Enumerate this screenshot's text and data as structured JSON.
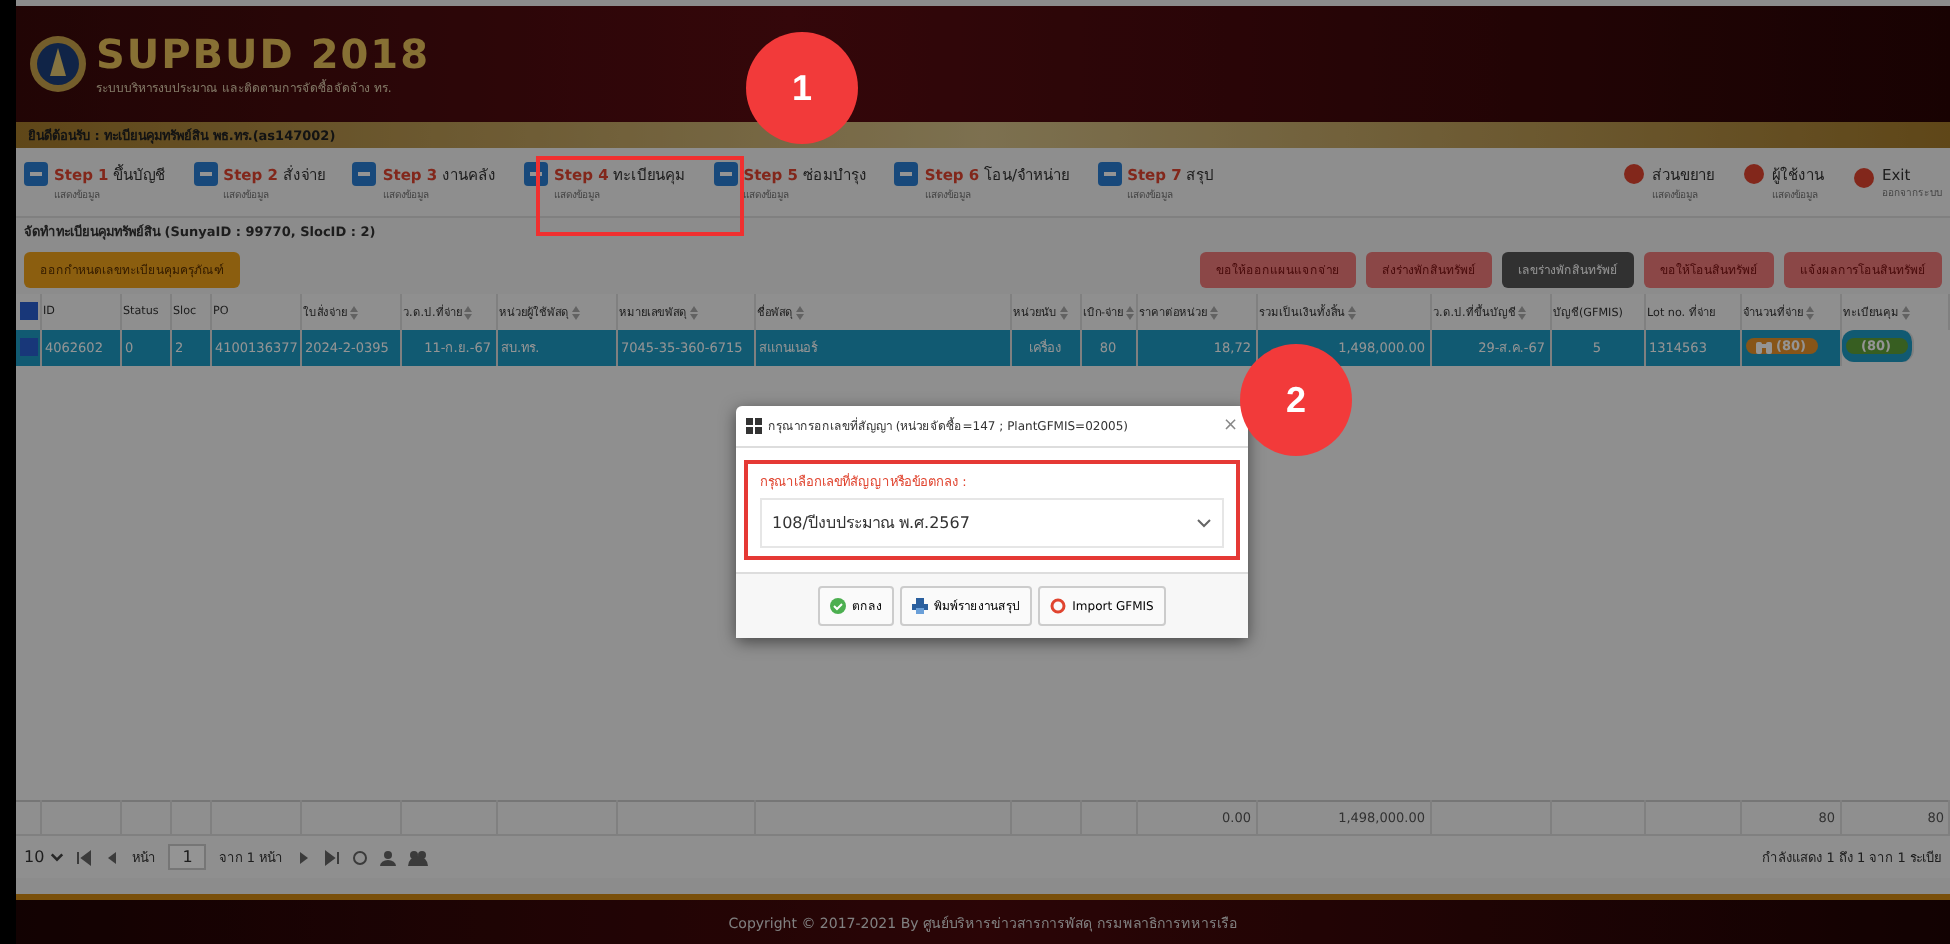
{
  "header": {
    "logo_text": "SUPBUD 2018",
    "subtitle": "ระบบบริหารงบประมาณ และติดตามการจัดซื้อจัดจ้าง ทร."
  },
  "welcome": "ยินดีต้อนรับ : ทะเบียนคุมทรัพย์สิน พธ.ทร.(as147002)",
  "steps": [
    {
      "step": "Step 1",
      "label": "ขึ้นบัญชี",
      "sub": "แสดงข้อมูล"
    },
    {
      "step": "Step 2",
      "label": "สั่งจ่าย",
      "sub": "แสดงข้อมูล"
    },
    {
      "step": "Step 3",
      "label": "งานคลัง",
      "sub": "แสดงข้อมูล"
    },
    {
      "step": "Step 4",
      "label": "ทะเบียนคุม",
      "sub": "แสดงข้อมูล"
    },
    {
      "step": "Step 5",
      "label": "ซ่อมบำรุง",
      "sub": "แสดงข้อมูล"
    },
    {
      "step": "Step 6",
      "label": "โอน/จำหน่าย",
      "sub": "แสดงข้อมูล"
    },
    {
      "step": "Step 7",
      "label": "สรุป",
      "sub": "แสดงข้อมูล"
    }
  ],
  "right_menu": [
    {
      "label": "ส่วนขยาย",
      "sub": "แสดงข้อมูล"
    },
    {
      "label": "ผู้ใช้งาน",
      "sub": "แสดงข้อมูล"
    },
    {
      "label": "Exit",
      "sub": "ออกจากระบบ"
    }
  ],
  "page_title": "จัดทำทะเบียนคุมทรัพย์สิน (SunyaID : 99770, SlocID : 2)",
  "left_action": "ออกกำหนดเลขทะเบียนคุมครุภัณฑ์",
  "actions": [
    {
      "label": "ขอให้ออกแผนแจกจ่าย",
      "kind": "red"
    },
    {
      "label": "ส่งร่างพักสินทรัพย์",
      "kind": "red"
    },
    {
      "label": "เลขร่างพักสินทรัพย์",
      "kind": "dark"
    },
    {
      "label": "ขอให้โอนสินทรัพย์",
      "kind": "red"
    },
    {
      "label": "แจ้งผลการโอนสินทรัพย์",
      "kind": "red"
    }
  ],
  "table": {
    "header_checked": true,
    "columns": [
      {
        "label": "ID",
        "sortable": false
      },
      {
        "label": "Status",
        "sortable": false
      },
      {
        "label": "Sloc",
        "sortable": false
      },
      {
        "label": "PO",
        "sortable": false
      },
      {
        "label": "ใบสั่งจ่าย",
        "sortable": true
      },
      {
        "label": "ว.ด.ป.ที่จ่าย",
        "sortable": true
      },
      {
        "label": "หน่วยผู้ใช้พัสดุ",
        "sortable": true
      },
      {
        "label": "หมายเลขพัสดุ",
        "sortable": true
      },
      {
        "label": "ชื่อพัสดุ",
        "sortable": true
      },
      {
        "label": "หน่วยนับ",
        "sortable": true
      },
      {
        "label": "เบิก-จ่าย",
        "sortable": true
      },
      {
        "label": "ราคาต่อหน่วย",
        "sortable": true
      },
      {
        "label": "รวมเป็นเงินทั้งสิ้น",
        "sortable": true,
        "total": "1,498,000.00"
      },
      {
        "label": "ว.ด.ป.ที่ขึ้นบัญชี",
        "sortable": true
      },
      {
        "label": "บัญชี(GFMIS)",
        "sortable": false
      },
      {
        "label": "Lot no. ที่จ่าย",
        "sortable": false
      },
      {
        "label": "จำนวนที่จ่าย",
        "sortable": true,
        "total": "80"
      },
      {
        "label": "ทะเบียนคุม",
        "sortable": true,
        "total": "80"
      }
    ],
    "rows": [
      {
        "selected": true,
        "checked": true,
        "cells": [
          {
            "text": "4062602",
            "kind": "text"
          },
          {
            "text": "0",
            "kind": "text"
          },
          {
            "text": "2",
            "kind": "text"
          },
          {
            "text": "4100136377",
            "kind": "text"
          },
          {
            "text": "2024-2-0395",
            "kind": "text"
          },
          {
            "text": "11-ก.ย.-67",
            "kind": "num"
          },
          {
            "text": "สบ.ทร.",
            "kind": "text"
          },
          {
            "text": "7045-35-360-6715",
            "kind": "text"
          },
          {
            "text": "สแกนเนอร์",
            "kind": "text"
          },
          {
            "text": "เครื่อง",
            "kind": "center"
          },
          {
            "text": "80",
            "kind": "center"
          },
          {
            "text": "18,72",
            "kind": "num"
          },
          {
            "text": "1,498,000.00",
            "kind": "num"
          },
          {
            "text": "29-ส.ค.-67",
            "kind": "num"
          },
          {
            "text": "5",
            "kind": "center"
          },
          {
            "text": "1314563",
            "kind": "text"
          },
          {
            "text": "(80)",
            "kind": "badge_icon"
          },
          {
            "text": "(80)",
            "kind": "badge"
          }
        ]
      }
    ],
    "price_total": "0.00"
  },
  "pager": {
    "page_size": "10",
    "page_label": "หน้า",
    "page": "1",
    "of": "จาก 1 หน้า",
    "info": "กำลังแสดง 1 ถึง 1 จาก 1 ระเบีย"
  },
  "footer": "Copyright © 2017-2021 By ศูนย์บริหารข่าวสารการพัสดุ กรมพลาธิการทหารเรือ",
  "dialog": {
    "title": "กรุณากรอกเลขที่สัญญา (หน่วยจัดซื้อ=147 ; PlantGFMIS=02005)",
    "close": "×",
    "label": "กรุณาเลือกเลขที่สัญญาหรือข้อตกลง :",
    "value": "108/ปีงบประมาณ พ.ศ.2567",
    "buttons": [
      "ตกลง",
      "พิมพ์รายงานสรุป",
      "Import GFMIS"
    ]
  },
  "callouts": [
    "1",
    "2"
  ]
}
